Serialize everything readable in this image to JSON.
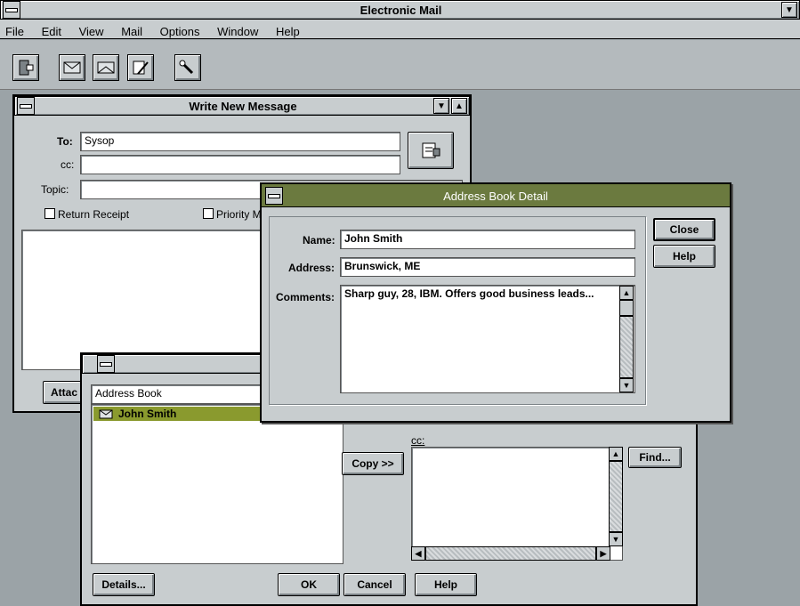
{
  "app": {
    "title": "Electronic Mail",
    "menu": [
      "File",
      "Edit",
      "View",
      "Mail",
      "Options",
      "Window",
      "Help"
    ]
  },
  "toolbar": {
    "icons": [
      "exit-icon",
      "mail-in-icon",
      "mail-out-icon",
      "compose-icon",
      "address-pen-icon"
    ]
  },
  "compose": {
    "title": "Write New Message",
    "to_label": "To:",
    "to_value": "Sysop",
    "cc_label": "cc:",
    "cc_value": "",
    "topic_label": "Topic:",
    "topic_value": "",
    "return_receipt": "Return Receipt",
    "priority_label": "Priority M",
    "attach_label": "Attac"
  },
  "addressbook": {
    "list_label": "Address Book",
    "entries": [
      "John Smith"
    ],
    "cc_label": "cc:",
    "copy_button": "Copy >>",
    "find_button": "Find...",
    "details_button": "Details...",
    "ok_button": "OK",
    "cancel_button": "Cancel",
    "help_button": "Help"
  },
  "detail": {
    "title": "Address Book Detail",
    "name_label": "Name:",
    "name_value": "John Smith",
    "address_label": "Address:",
    "address_value": "Brunswick, ME",
    "comments_label": "Comments:",
    "comments_value": "Sharp guy, 28, IBM. Offers good business leads...",
    "close_button": "Close",
    "help_button": "Help"
  },
  "colors": {
    "desktop": "#9ba3a7",
    "titlebar": "#c8cdcf",
    "active_titlebar": "#6b7a3f",
    "selection": "#8a9a2e"
  }
}
